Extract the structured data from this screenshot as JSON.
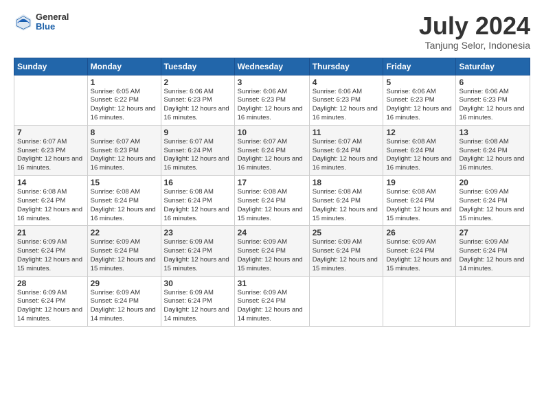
{
  "header": {
    "logo": {
      "line1": "General",
      "line2": "Blue"
    },
    "title": "July 2024",
    "location": "Tanjung Selor, Indonesia"
  },
  "days_of_week": [
    "Sunday",
    "Monday",
    "Tuesday",
    "Wednesday",
    "Thursday",
    "Friday",
    "Saturday"
  ],
  "weeks": [
    [
      {
        "day": "",
        "info": ""
      },
      {
        "day": "1",
        "info": "Sunrise: 6:05 AM\nSunset: 6:22 PM\nDaylight: 12 hours and 16 minutes."
      },
      {
        "day": "2",
        "info": "Sunrise: 6:06 AM\nSunset: 6:23 PM\nDaylight: 12 hours and 16 minutes."
      },
      {
        "day": "3",
        "info": "Sunrise: 6:06 AM\nSunset: 6:23 PM\nDaylight: 12 hours and 16 minutes."
      },
      {
        "day": "4",
        "info": "Sunrise: 6:06 AM\nSunset: 6:23 PM\nDaylight: 12 hours and 16 minutes."
      },
      {
        "day": "5",
        "info": "Sunrise: 6:06 AM\nSunset: 6:23 PM\nDaylight: 12 hours and 16 minutes."
      },
      {
        "day": "6",
        "info": "Sunrise: 6:06 AM\nSunset: 6:23 PM\nDaylight: 12 hours and 16 minutes."
      }
    ],
    [
      {
        "day": "7",
        "info": ""
      },
      {
        "day": "8",
        "info": "Sunrise: 6:07 AM\nSunset: 6:23 PM\nDaylight: 12 hours and 16 minutes."
      },
      {
        "day": "9",
        "info": "Sunrise: 6:07 AM\nSunset: 6:24 PM\nDaylight: 12 hours and 16 minutes."
      },
      {
        "day": "10",
        "info": "Sunrise: 6:07 AM\nSunset: 6:24 PM\nDaylight: 12 hours and 16 minutes."
      },
      {
        "day": "11",
        "info": "Sunrise: 6:07 AM\nSunset: 6:24 PM\nDaylight: 12 hours and 16 minutes."
      },
      {
        "day": "12",
        "info": "Sunrise: 6:08 AM\nSunset: 6:24 PM\nDaylight: 12 hours and 16 minutes."
      },
      {
        "day": "13",
        "info": "Sunrise: 6:08 AM\nSunset: 6:24 PM\nDaylight: 12 hours and 16 minutes."
      }
    ],
    [
      {
        "day": "14",
        "info": ""
      },
      {
        "day": "15",
        "info": "Sunrise: 6:08 AM\nSunset: 6:24 PM\nDaylight: 12 hours and 16 minutes."
      },
      {
        "day": "16",
        "info": "Sunrise: 6:08 AM\nSunset: 6:24 PM\nDaylight: 12 hours and 16 minutes."
      },
      {
        "day": "17",
        "info": "Sunrise: 6:08 AM\nSunset: 6:24 PM\nDaylight: 12 hours and 15 minutes."
      },
      {
        "day": "18",
        "info": "Sunrise: 6:08 AM\nSunset: 6:24 PM\nDaylight: 12 hours and 15 minutes."
      },
      {
        "day": "19",
        "info": "Sunrise: 6:08 AM\nSunset: 6:24 PM\nDaylight: 12 hours and 15 minutes."
      },
      {
        "day": "20",
        "info": "Sunrise: 6:09 AM\nSunset: 6:24 PM\nDaylight: 12 hours and 15 minutes."
      }
    ],
    [
      {
        "day": "21",
        "info": ""
      },
      {
        "day": "22",
        "info": "Sunrise: 6:09 AM\nSunset: 6:24 PM\nDaylight: 12 hours and 15 minutes."
      },
      {
        "day": "23",
        "info": "Sunrise: 6:09 AM\nSunset: 6:24 PM\nDaylight: 12 hours and 15 minutes."
      },
      {
        "day": "24",
        "info": "Sunrise: 6:09 AM\nSunset: 6:24 PM\nDaylight: 12 hours and 15 minutes."
      },
      {
        "day": "25",
        "info": "Sunrise: 6:09 AM\nSunset: 6:24 PM\nDaylight: 12 hours and 15 minutes."
      },
      {
        "day": "26",
        "info": "Sunrise: 6:09 AM\nSunset: 6:24 PM\nDaylight: 12 hours and 15 minutes."
      },
      {
        "day": "27",
        "info": "Sunrise: 6:09 AM\nSunset: 6:24 PM\nDaylight: 12 hours and 14 minutes."
      }
    ],
    [
      {
        "day": "28",
        "info": "Sunrise: 6:09 AM\nSunset: 6:24 PM\nDaylight: 12 hours and 14 minutes."
      },
      {
        "day": "29",
        "info": "Sunrise: 6:09 AM\nSunset: 6:24 PM\nDaylight: 12 hours and 14 minutes."
      },
      {
        "day": "30",
        "info": "Sunrise: 6:09 AM\nSunset: 6:24 PM\nDaylight: 12 hours and 14 minutes."
      },
      {
        "day": "31",
        "info": "Sunrise: 6:09 AM\nSunset: 6:24 PM\nDaylight: 12 hours and 14 minutes."
      },
      {
        "day": "",
        "info": ""
      },
      {
        "day": "",
        "info": ""
      },
      {
        "day": "",
        "info": ""
      }
    ]
  ],
  "week7_sunday_info": "Sunrise: 6:07 AM\nSunset: 6:23 PM\nDaylight: 12 hours and 16 minutes.",
  "week14_sunday_info": "Sunrise: 6:08 AM\nSunset: 6:24 PM\nDaylight: 12 hours and 16 minutes.",
  "week21_sunday_info": "Sunrise: 6:09 AM\nSunset: 6:24 PM\nDaylight: 12 hours and 15 minutes."
}
